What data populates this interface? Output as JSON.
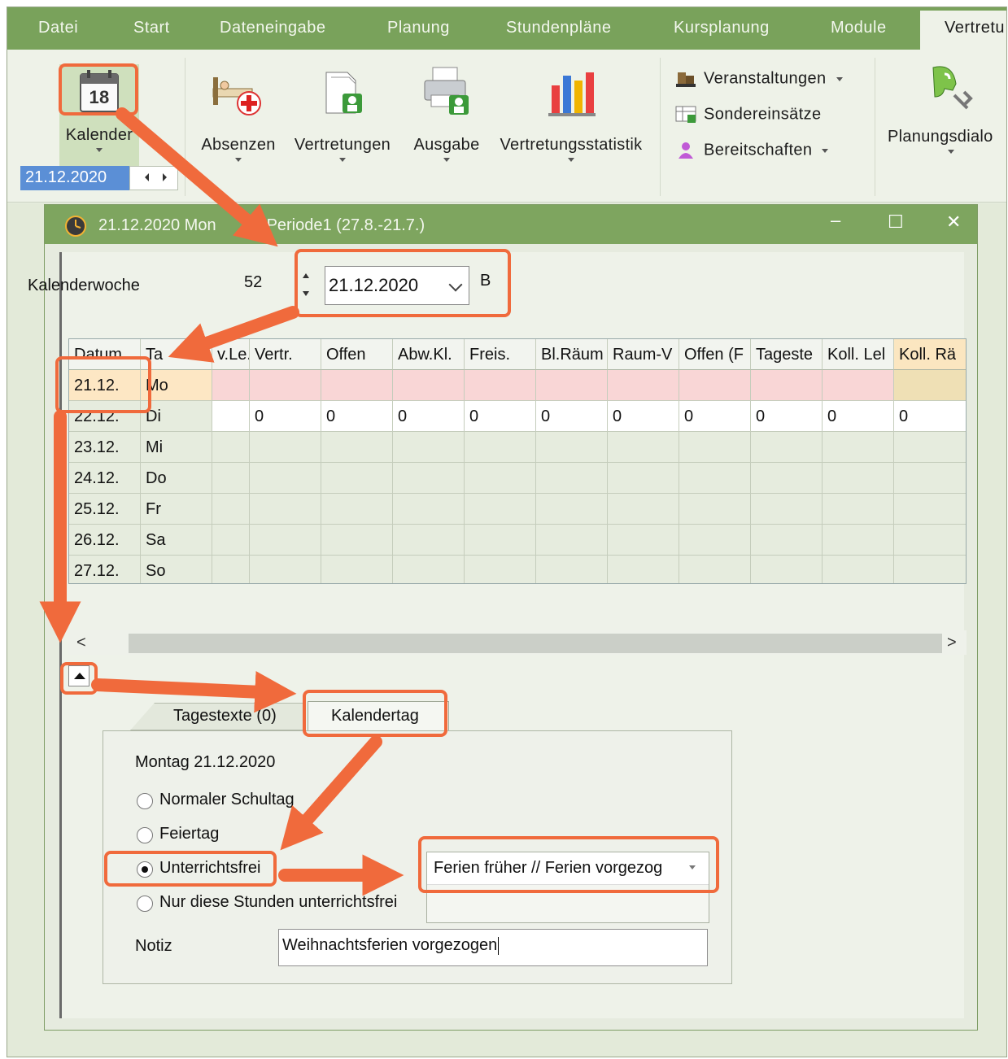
{
  "tabs": [
    "Datei",
    "Start",
    "Dateneingabe",
    "Planung",
    "Stundenpläne",
    "Kursplanung",
    "Module",
    "Vertretu"
  ],
  "ribbon": {
    "kalender_label": "Kalender",
    "calendar_icon_number": "18",
    "date_value": "21.12.2020",
    "absenzen_label": "Absenzen",
    "vertretungen_label": "Vertretungen",
    "ausgabe_label": "Ausgabe",
    "statistik_label": "Vertretungsstatistik",
    "veranstaltungen_label": "Veranstaltungen",
    "sondereinsaetze_label": "Sondereinsätze",
    "bereitschaften_label": "Bereitschaften",
    "planungsdialog_label": "Planungsdialo"
  },
  "window": {
    "title_left": "21.12.2020 Mon",
    "title_right": "Periode1 (27.8.-21.7.)",
    "min_symbol": "–",
    "max_symbol": "☐",
    "close_symbol": "✕"
  },
  "week": {
    "label": "Kalenderwoche",
    "number": "52",
    "date": "21.12.2020",
    "suffix": "B"
  },
  "grid": {
    "columns": [
      "Datum",
      "Ta",
      "v.Le.",
      "Vertr.",
      "Offen",
      "Abw.Kl.",
      "Freis.",
      "Bl.Räum",
      "Raum-V",
      "Offen (F",
      "Tageste",
      "Koll. Lel",
      "Koll. Rä"
    ],
    "rows": [
      [
        "21.12.",
        "Mo",
        "",
        "",
        "",
        "",
        "",
        "",
        "",
        "",
        "",
        "",
        ""
      ],
      [
        "22.12.",
        "Di",
        "",
        "0",
        "0",
        "0",
        "0",
        "0",
        "0",
        "0",
        "0",
        "0",
        "0"
      ],
      [
        "23.12.",
        "Mi",
        "",
        "",
        "",
        "",
        "",
        "",
        "",
        "",
        "",
        "",
        ""
      ],
      [
        "24.12.",
        "Do",
        "",
        "",
        "",
        "",
        "",
        "",
        "",
        "",
        "",
        "",
        ""
      ],
      [
        "25.12.",
        "Fr",
        "",
        "",
        "",
        "",
        "",
        "",
        "",
        "",
        "",
        "",
        ""
      ],
      [
        "26.12.",
        "Sa",
        "",
        "",
        "",
        "",
        "",
        "",
        "",
        "",
        "",
        "",
        ""
      ],
      [
        "27.12.",
        "So",
        "",
        "",
        "",
        "",
        "",
        "",
        "",
        "",
        "",
        "",
        ""
      ]
    ]
  },
  "scroll": {
    "left": "<",
    "right": ">"
  },
  "detail": {
    "tab_tagestexte": "Tagestexte (0)",
    "tab_kalendertag": "Kalendertag",
    "day_heading": "Montag 21.12.2020",
    "radio_normal": "Normaler Schultag",
    "radio_feiertag": "Feiertag",
    "radio_unterrichtsfrei": "Unterrichtsfrei",
    "radio_nur_stunden": "Nur diese Stunden unterrichtsfrei",
    "holiday_value": "Ferien früher // Ferien vorgezog",
    "note_label": "Notiz",
    "note_value": "Weihnachtsferien vorgezogen"
  },
  "colors": {
    "accent_green": "#79a25b",
    "highlight_orange": "#f06a3c",
    "selected_row_pink": "#f9d6d6",
    "selected_date_cell": "#fde7c4"
  }
}
